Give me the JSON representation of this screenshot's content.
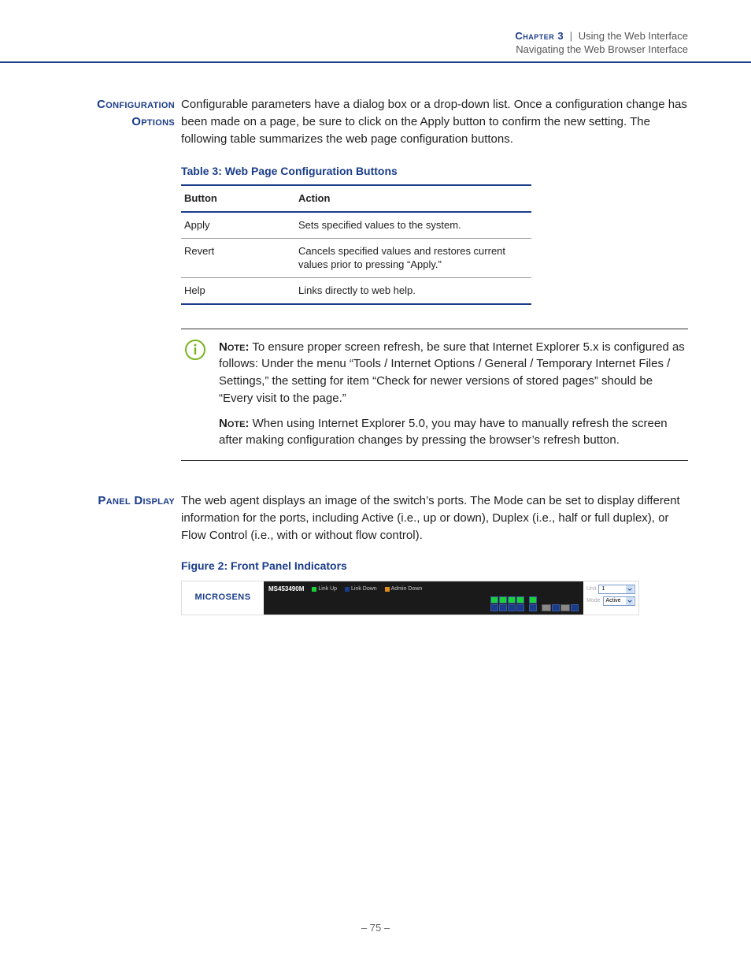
{
  "header": {
    "chapter": "Chapter 3",
    "pipe": "|",
    "title": "Using the Web Interface",
    "subtitle": "Navigating the Web Browser Interface"
  },
  "section1": {
    "label_line1": "Configuration",
    "label_line2": "Options",
    "body": "Configurable parameters have a dialog box or a drop-down list. Once a configuration change has been made on a page, be sure to click on the Apply button to confirm the new setting. The following table summarizes the web page configuration buttons.",
    "table_caption": "Table 3: Web Page Configuration Buttons",
    "th_button": "Button",
    "th_action": "Action",
    "rows": [
      {
        "button": "Apply",
        "action": "Sets specified values to the system."
      },
      {
        "button": "Revert",
        "action": "Cancels specified values and restores current values prior to pressing “Apply.”"
      },
      {
        "button": "Help",
        "action": "Links directly to web help."
      }
    ]
  },
  "notes": {
    "label": "Note:",
    "note1_rest": " To ensure proper screen refresh, be sure that Internet Explorer 5.x is configured as follows: Under the menu “Tools / Internet Options / General / Temporary Internet Files / Settings,” the setting for item “Check for newer versions of stored pages” should be “Every visit to the page.”",
    "note2_rest": " When using Internet Explorer 5.0, you may have to manually refresh the screen after making configuration changes by pressing the browser’s refresh button."
  },
  "section2": {
    "label": "Panel Display",
    "body": "The web agent displays an image of the switch’s ports. The Mode can be set to display different information for the ports, including Active (i.e., up or down), Duplex (i.e., half or full duplex), or Flow Control (i.e., with or without flow control).",
    "figure_caption": "Figure 2:  Front Panel Indicators"
  },
  "panel": {
    "brand": "MICROSENS",
    "model": "MS453490M",
    "legend": {
      "link_up": "Link Up",
      "link_down": "Link Down",
      "admin_down": "Admin Down"
    },
    "right": {
      "label1": "Unit",
      "select1": "1",
      "label2": "Mode",
      "select2": "Active"
    }
  },
  "page_number": "–  75  –",
  "colors": {
    "brand_blue": "#1a3c8a",
    "link_up": "#1bd13a",
    "link_down": "#1a3c8a",
    "admin_down": "#e08b1c"
  }
}
